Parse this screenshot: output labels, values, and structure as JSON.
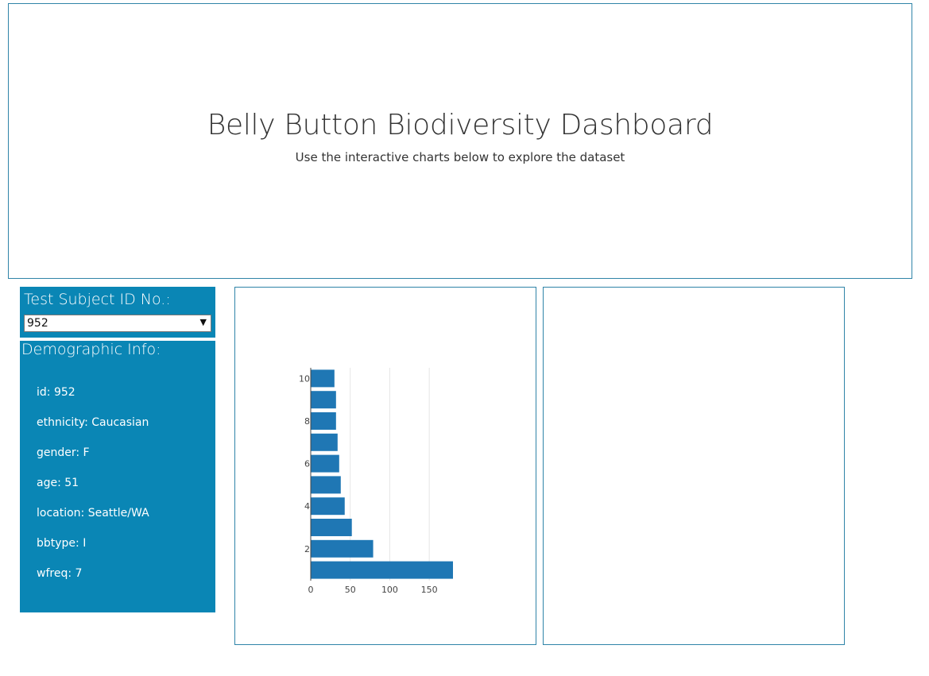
{
  "header": {
    "title": "Belly Button Biodiversity Dashboard",
    "subtitle": "Use the interactive charts below to explore the dataset"
  },
  "selector": {
    "label": "Test Subject ID No.:",
    "selected": "952"
  },
  "demographics": {
    "label": "Demographic Info:",
    "items": [
      "id: 952",
      "ethnicity: Caucasian",
      "gender: F",
      "age: 51",
      "location: Seattle/WA",
      "bbtype: I",
      "wfreq: 7"
    ]
  },
  "colors": {
    "panel": "#0a86b5",
    "bar": "#1f77b4",
    "border": "#2f84a8"
  },
  "chart_data": {
    "type": "bar",
    "orientation": "horizontal",
    "categories": [
      1,
      2,
      3,
      4,
      5,
      6,
      7,
      8,
      9,
      10
    ],
    "values": [
      180,
      79,
      52,
      43,
      38,
      36,
      34,
      32,
      32,
      30
    ],
    "xlim": [
      0,
      180
    ],
    "ylim": [
      0.5,
      10.5
    ],
    "x_ticks": [
      0,
      50,
      100,
      150
    ],
    "y_ticks": [
      2,
      4,
      6,
      8,
      10
    ],
    "grid": "vertical"
  }
}
